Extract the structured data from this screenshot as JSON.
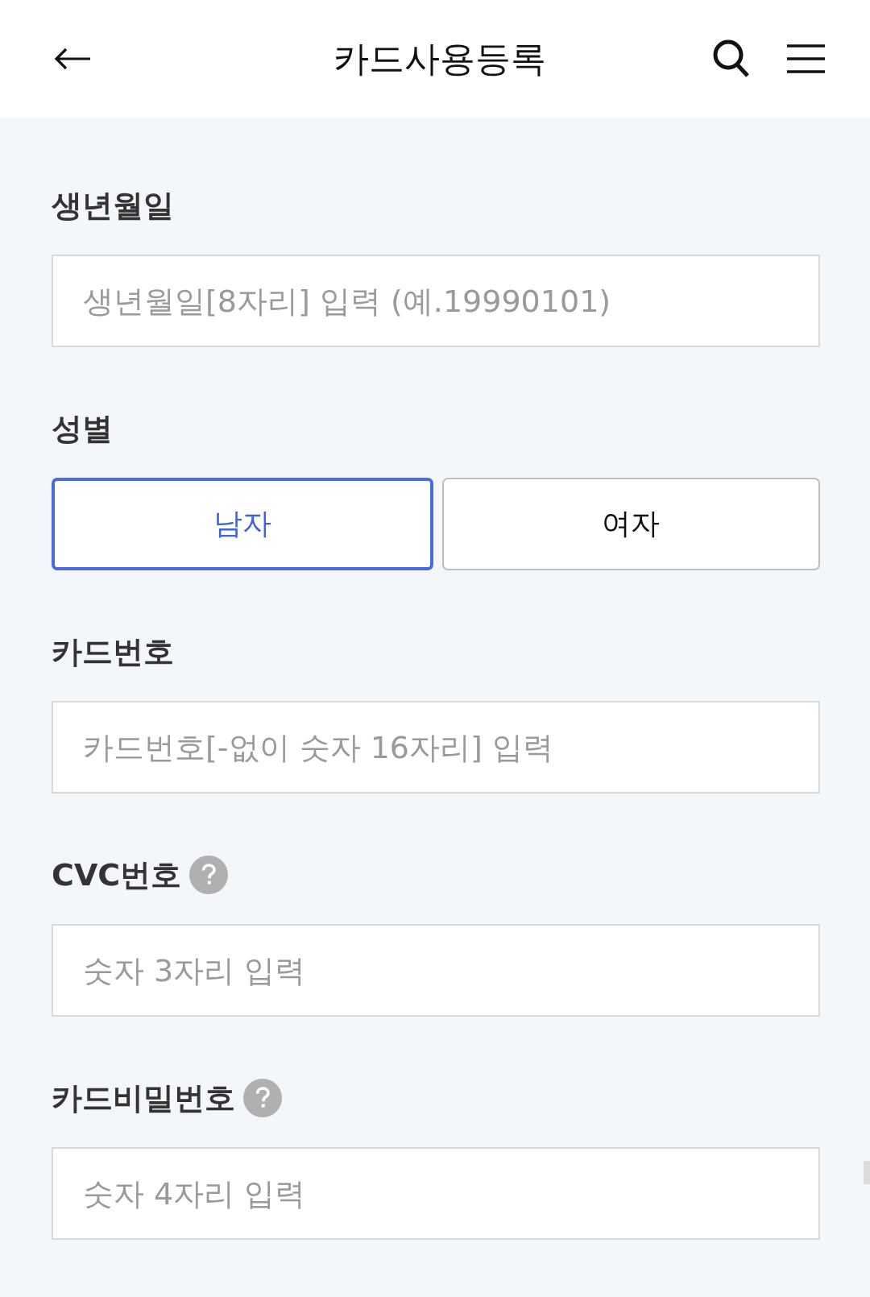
{
  "header": {
    "title": "카드사용등록"
  },
  "form": [
    {
      "kind": "text_input",
      "label": "생년월일",
      "help": false,
      "placeholder": "생년월일[8자리] 입력 (예.19990101)"
    },
    {
      "kind": "choice",
      "label": "성별",
      "help": false,
      "options": [
        {
          "label": "남자",
          "selected": true
        },
        {
          "label": "여자",
          "selected": false
        }
      ]
    },
    {
      "kind": "text_input",
      "label": "카드번호",
      "help": false,
      "placeholder": "카드번호[-없이 숫자 16자리] 입력"
    },
    {
      "kind": "text_input",
      "label": "CVC번호",
      "help": true,
      "placeholder": "숫자 3자리 입력"
    },
    {
      "kind": "text_input",
      "label": "카드비밀번호",
      "help": true,
      "placeholder": "숫자 4자리 입력"
    }
  ]
}
